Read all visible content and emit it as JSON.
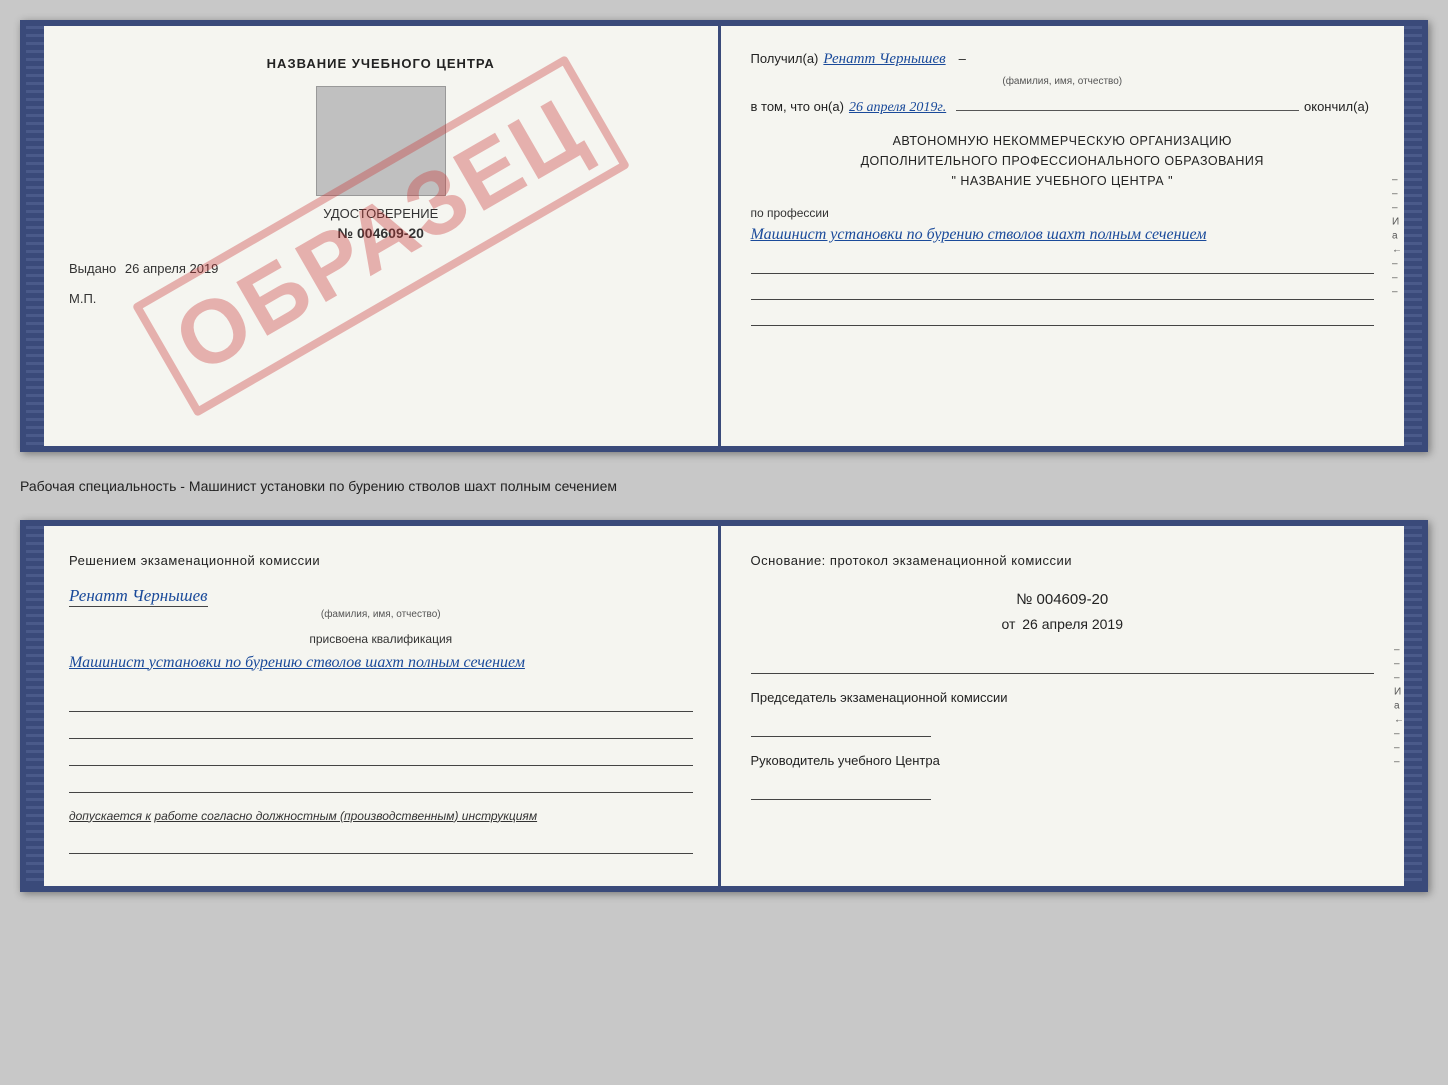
{
  "top_doc": {
    "left": {
      "title": "НАЗВАНИЕ УЧЕБНОГО ЦЕНТРА",
      "udostoverenie_label": "УДОСТОВЕРЕНИЕ",
      "number": "№ 004609-20",
      "vydano_label": "Выдано",
      "vydano_date": "26 апреля 2019",
      "mp_label": "М.П.",
      "watermark": "ОБРАЗЕЦ"
    },
    "right": {
      "poluchil_label": "Получил(а)",
      "poluchil_name": "Ренатт Чернышев",
      "fio_sub": "(фамилия, имя, отчество)",
      "dash": "–",
      "vtom_label": "в том, что он(а)",
      "vtom_date": "26 апреля 2019г.",
      "okonchil_label": "окончил(а)",
      "org_line1": "АВТОНОМНУЮ НЕКОММЕРЧЕСКУЮ ОРГАНИЗАЦИЮ",
      "org_line2": "ДОПОЛНИТЕЛЬНОГО ПРОФЕССИОНАЛЬНОГО ОБРАЗОВАНИЯ",
      "org_line3": "\"  НАЗВАНИЕ УЧЕБНОГО ЦЕНТРА  \"",
      "po_professii_label": "по профессии",
      "profession": "Машинист установки по бурению стволов шахт полным сечением"
    }
  },
  "specialty_label": "Рабочая специальность - Машинист установки по бурению стволов шахт полным сечением",
  "bottom_doc": {
    "left": {
      "komissia_title": "Решением  экзаменационной  комиссии",
      "name": "Ренатт Чернышев",
      "fio_sub": "(фамилия, имя, отчество)",
      "prisvoena_label": "присвоена квалификация",
      "kvalifikacia": "Машинист установки по бурению стволов шахт полным сечением",
      "dopuskaetsya_label": "допускается к",
      "dopuskaetsya_value": "работе согласно должностным (производственным) инструкциям"
    },
    "right": {
      "osnov_label": "Основание:  протокол  экзаменационной  комиссии",
      "proto_number": "№  004609-20",
      "ot_label": "от",
      "proto_date": "26 апреля 2019",
      "predsedatel_label": "Председатель экзаменационной комиссии",
      "rukovoditel_label": "Руководитель учебного Центра"
    }
  },
  "side_indicators": [
    "–",
    "–",
    "–",
    "И",
    "а",
    "←",
    "–",
    "–",
    "–"
  ]
}
